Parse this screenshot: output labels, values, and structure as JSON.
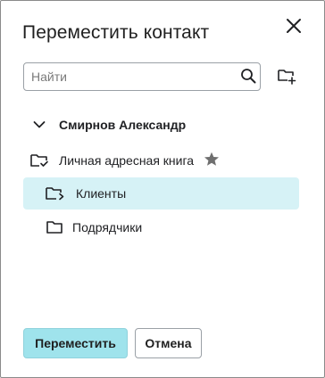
{
  "dialog": {
    "title": "Переместить контакт",
    "close_icon": "close-icon"
  },
  "search": {
    "placeholder": "Найти",
    "value": "",
    "icon": "search-icon"
  },
  "new_folder_icon": "folder-plus-icon",
  "tree": {
    "owner": {
      "label": "Смирнов Александр",
      "icon": "chevron-down-icon"
    },
    "personal": {
      "label": "Личная адресная книга",
      "icon": "folder-check-icon",
      "star_icon": "star-icon"
    },
    "children": [
      {
        "label": "Клиенты",
        "icon": "folder-arrow-icon",
        "selected": true
      },
      {
        "label": "Подрядчики",
        "icon": "folder-icon",
        "selected": false
      }
    ]
  },
  "actions": {
    "move_label": "Переместить",
    "cancel_label": "Отмена"
  },
  "colors": {
    "selected_row": "#d6f2f6",
    "primary_button": "#9fe3ec",
    "border": "#8a8a8a",
    "star": "#6f6f6f"
  }
}
